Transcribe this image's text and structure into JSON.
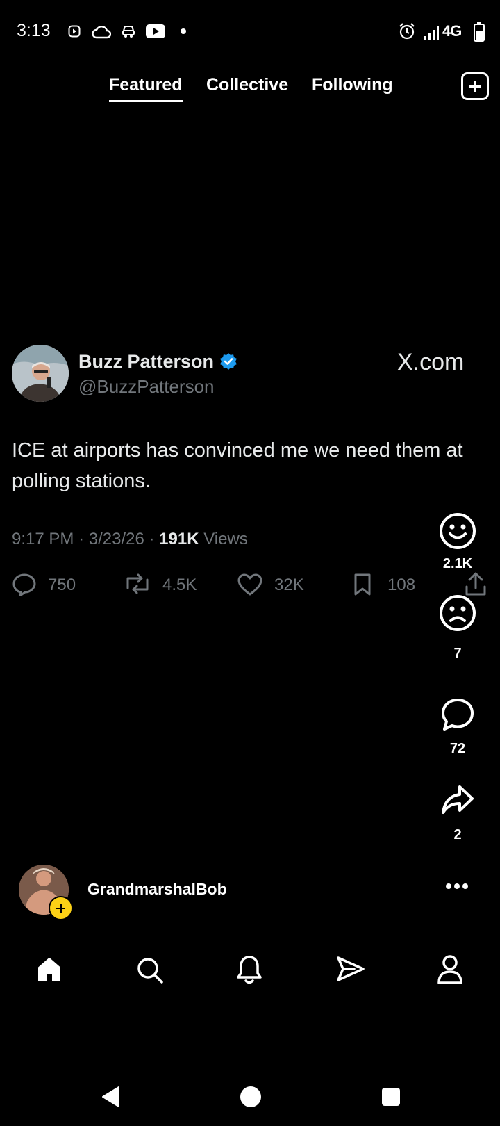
{
  "status_bar": {
    "time": "3:13",
    "network": "4G",
    "icons": [
      "screen-record-icon",
      "cloud-icon",
      "car-icon",
      "youtube-icon",
      "dot-icon",
      "alarm-icon",
      "signal-icon",
      "battery-icon"
    ]
  },
  "tabs": [
    {
      "label": "Featured",
      "active": true
    },
    {
      "label": "Collective",
      "active": false
    },
    {
      "label": "Following",
      "active": false
    }
  ],
  "post": {
    "author_name": "Buzz Patterson",
    "author_handle": "@BuzzPatterson",
    "source": "X.com",
    "text": "ICE at airports has convinced me we need them at polling stations.",
    "time": "9:17 PM",
    "date": "3/23/26",
    "views": "191K",
    "views_label": "Views",
    "replies": "750",
    "reposts": "4.5K",
    "likes": "32K",
    "bookmarks": "108"
  },
  "rail": {
    "happy": "2.1K",
    "sad": "7",
    "comments": "72",
    "shares": "2"
  },
  "creator": {
    "name": "GrandmarshalBob"
  },
  "bottom_nav": [
    "home-icon",
    "search-icon",
    "bell-icon",
    "send-icon",
    "profile-icon"
  ],
  "colors": {
    "background": "#000000",
    "text": "#e7e9ea",
    "muted": "#71767b",
    "verified": "#1d9bf0",
    "follow_badge": "#fcd116"
  }
}
